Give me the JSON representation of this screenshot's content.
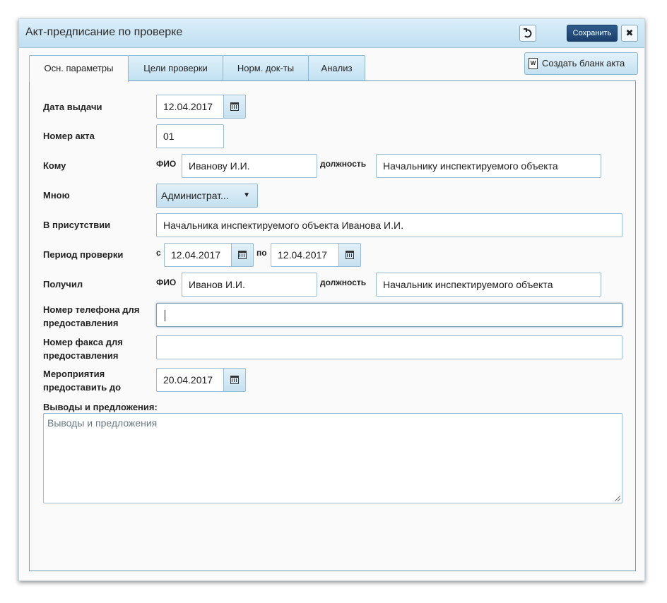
{
  "window": {
    "title": "Акт-предписание по проверке",
    "save_label": "Сохранить",
    "close_glyph": "✖",
    "restore_glyph": "⟲"
  },
  "tabs": [
    {
      "label": "Осн. параметры",
      "active": true
    },
    {
      "label": "Цели проверки",
      "active": false
    },
    {
      "label": "Норм. док-ты",
      "active": false
    },
    {
      "label": "Анализ",
      "active": false
    }
  ],
  "create_blank_label": "Создать бланк акта",
  "form": {
    "issue_date": {
      "label": "Дата выдачи",
      "value": "12.04.2017"
    },
    "act_number": {
      "label": "Номер акта",
      "value": "01"
    },
    "to": {
      "label": "Кому",
      "fio_label": "ФИО",
      "fio": "Иванову И.И.",
      "position_label": "должность",
      "position": "Начальнику инспектируемого объекта"
    },
    "by_me": {
      "label": "Мною",
      "value": "Администрат..."
    },
    "in_presence": {
      "label": "В присутствии",
      "value": "Начальника инспектируемого объекта Иванова И.И."
    },
    "period": {
      "label": "Период проверки",
      "from_label": "с",
      "from": "12.04.2017",
      "to_label": "по",
      "to": "12.04.2017"
    },
    "received": {
      "label": "Получил",
      "fio_label": "ФИО",
      "fio": "Иванов И.И.",
      "position_label": "должность",
      "position": "Начальник инспектируемого объекта"
    },
    "phone": {
      "label_line1": "Номер телефона для",
      "label_line2": "предоставления",
      "value": ""
    },
    "fax": {
      "label_line1": "Номер факса для",
      "label_line2": "предоставления",
      "value": ""
    },
    "deadline": {
      "label_line1": "Мероприятия",
      "label_line2": "предоставить до",
      "value": "20.04.2017"
    },
    "conclusions": {
      "label": "Выводы и предложения:",
      "placeholder": "Выводы и предложения"
    }
  },
  "icons": {
    "calendar": "calendar-icon",
    "dropdown": "▼",
    "doc": "W"
  }
}
